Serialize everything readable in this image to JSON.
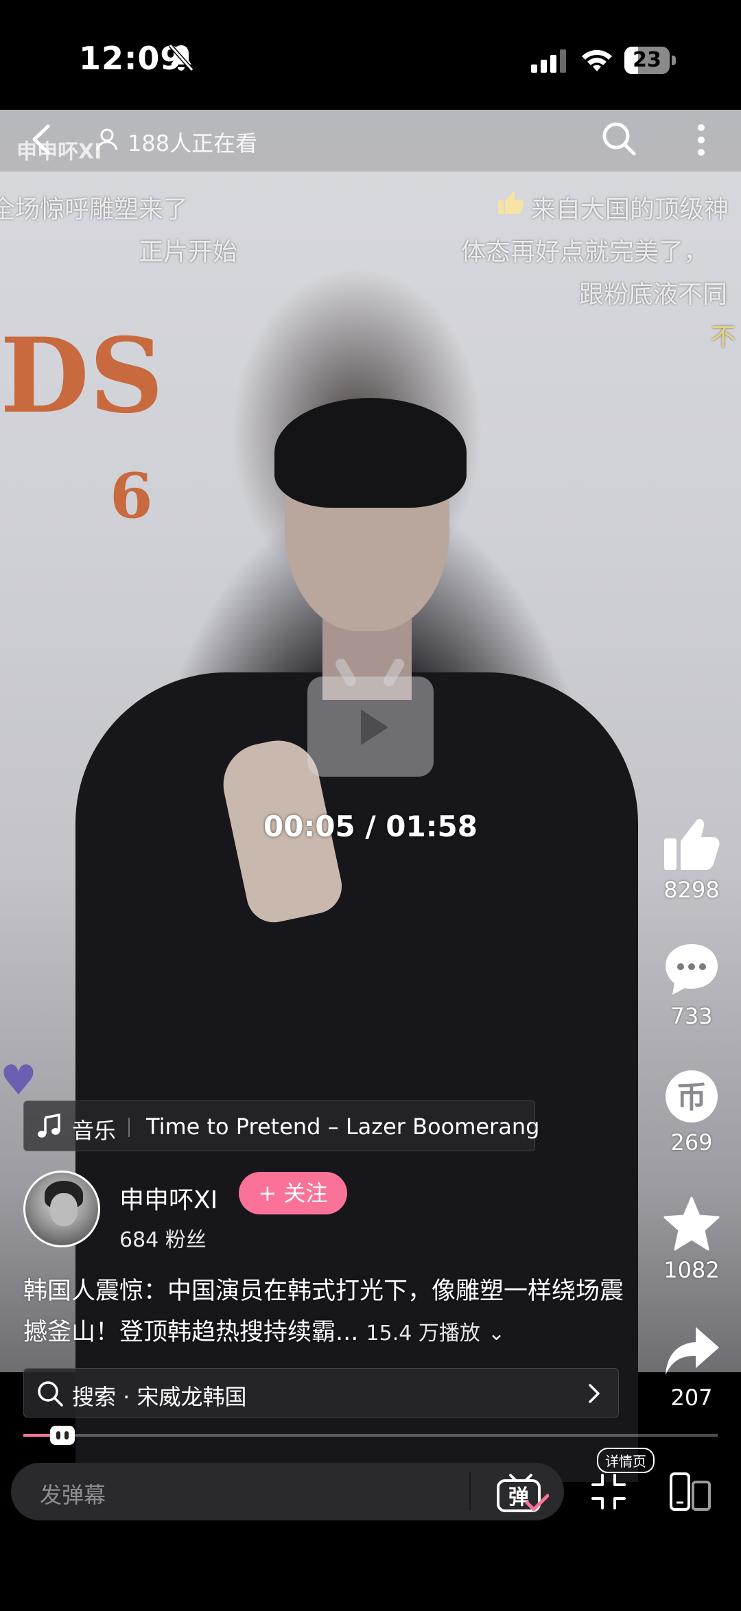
{
  "status_bar": {
    "time": "12:09",
    "battery": "23",
    "muted": true
  },
  "top_bar": {
    "uploader_watermark": "申申吥XI",
    "viewer_count": "188人正在看"
  },
  "danmaku": [
    "全场惊呼雕塑来了",
    "正片开始",
    "来自大国的顶级神",
    "体态再好点就完美了，",
    "跟粉底液不同",
    "不"
  ],
  "player": {
    "time_readout": "00:05 / 01:58",
    "progress": 0.042
  },
  "actions": {
    "likes": "8298",
    "comments": "733",
    "coins": "269",
    "favorites": "1082",
    "shares": "207"
  },
  "music": {
    "label": "音乐",
    "title": "Time to Pretend – Lazer Boomerang"
  },
  "author": {
    "name": "申申吥XI",
    "follow_label": "+ 关注",
    "fans": "684 粉丝"
  },
  "description": {
    "text": "韩国人震惊：中国演员在韩式打光下，像雕塑一样绕场震撼釜山！登顶韩趋热搜持续霸...",
    "play_count": "15.4 万播放"
  },
  "search_suggestion": "搜索 · 宋威龙韩国",
  "bottom_bar": {
    "comment_placeholder": "发弹幕",
    "danmaku_toggle_label": "弹",
    "details_label": "详情页"
  },
  "colors": {
    "accent": "#fb7299",
    "background": "#000000"
  }
}
